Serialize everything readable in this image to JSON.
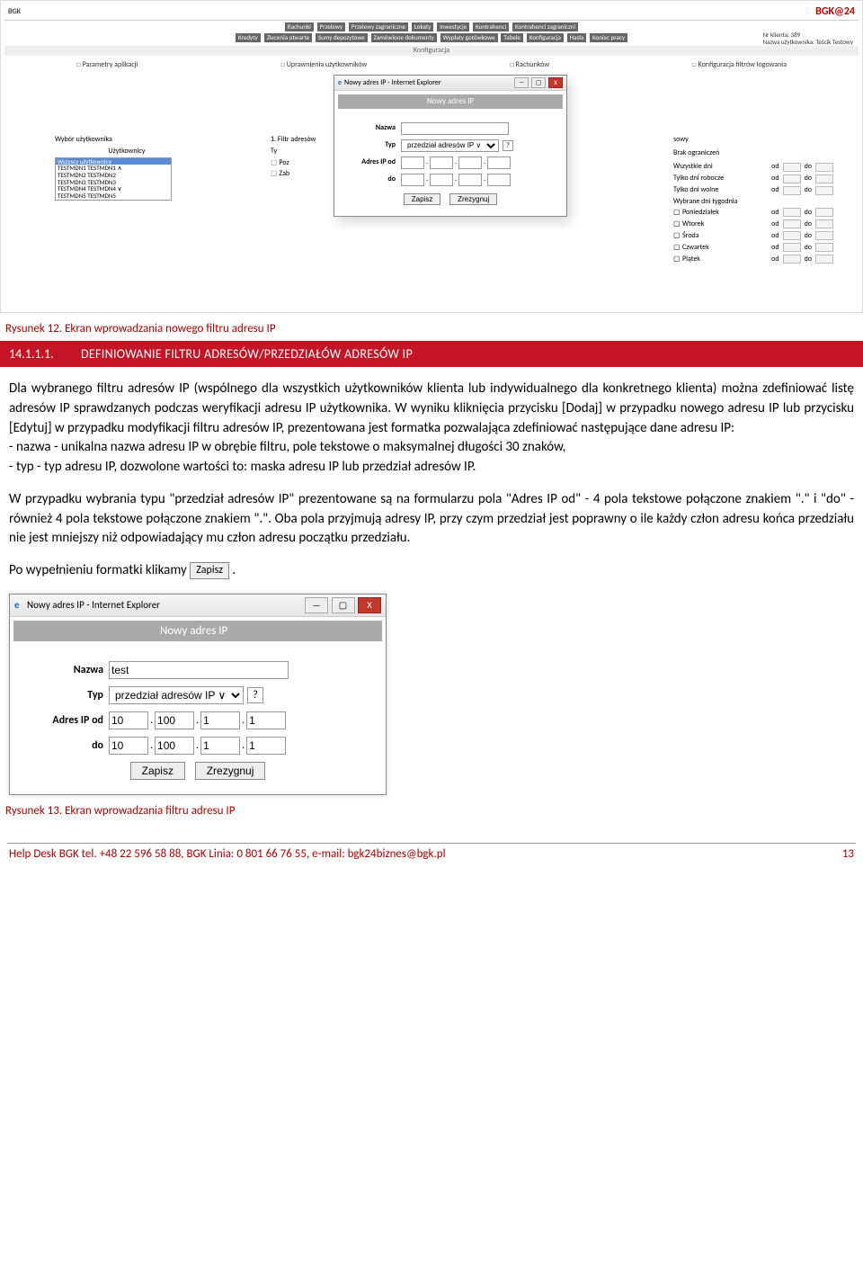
{
  "app": {
    "logo": "BGK",
    "brand": "BGK@24",
    "menu1": [
      "Rachunki",
      "Przelewy",
      "Przelewy zagraniczne",
      "Lokaty",
      "Inwestycje",
      "Kontrahenci",
      "Kontrahenci zagraniczni"
    ],
    "menu2": [
      "Kredyty",
      "Zlecenia otwarte",
      "Sumy depozytowe",
      "Zamówione dokumenty",
      "Wypłaty gotówkowe",
      "Tabele",
      "Konfiguracja",
      "Hasła",
      "Koniec pracy"
    ],
    "client_line1": "Nr klienta: 389",
    "client_line2": "Nazwa użytkownika: Teścik Testowy",
    "cfg": "Konfiguracja",
    "tabs": [
      "Parametry aplikacji",
      "Uprawnienia użytkowników",
      "Konfiguracja filtrów logowania"
    ],
    "tabs_mid": "Rachunków",
    "left": {
      "label": "Wybór użytkownika",
      "uz": "Użytkownicy",
      "sel": "Wszyscy użytkownicy",
      "items": [
        "TESTMDN1 TESTMDN1 ∧",
        "TESTMDN2 TESTMDN2",
        "TESTMDN3 TESTMDN3",
        "TESTMDN4 TESTMDN4 ∨",
        "TESTMDN5 TESTMDN5"
      ]
    },
    "mid": {
      "label": "1. Filtr adresów",
      "ty": "Ty",
      "ck1": "Poz",
      "ck2": "Zab"
    },
    "right": {
      "hdr": "sowy",
      "sub": "Brak ograniczeń",
      "rows": [
        "Wszystkie dni",
        "Tylko dni robocze",
        "Tylko dni wolne",
        "Wybrane dni tygodnia",
        "Poniedziałek",
        "Wtorek",
        "Środa",
        "Czwartek",
        "Piątek"
      ],
      "od": "od",
      "do": "do"
    }
  },
  "dialog_small": {
    "title": "Nowy adres IP - Internet Explorer",
    "sub": "Nowy adres IP",
    "nazwa_label": "Nazwa",
    "typ_label": "Typ",
    "typ_value": "przedział adresów IP ∨",
    "ip_od_label": "Adres IP od",
    "do_label": "do",
    "zapisz": "Zapisz",
    "zrezygnuj": "Zrezygnuj"
  },
  "caption12": "Rysunek 12. Ekran wprowadzania nowego filtru adresu IP",
  "heading": {
    "num": "14.1.1.1.",
    "title": "DEFINIOWANIE FILTRU ADRESÓW/PRZEDZIAŁÓW ADRESÓW IP"
  },
  "p1": "Dla wybranego filtru adresów IP (wspólnego dla wszystkich użytkowników klienta lub indywidualnego dla konkretnego klienta) można zdefiniować listę adresów IP sprawdzanych podczas weryfikacji adresu IP użytkownika. W wyniku kliknięcia przycisku [Dodaj] w przypadku nowego adresu IP lub przycisku [Edytuj] w przypadku modyfikacji filtru adresów IP, prezentowana jest formatka pozwalająca zdefiniować następujące dane adresu IP:",
  "p1b": "- nazwa - unikalna nazwa adresu IP w obrębie filtru, pole tekstowe o maksymalnej długości 30 znaków,",
  "p1c": "- typ - typ adresu IP, dozwolone wartości to: maska adresu IP lub przedział adresów IP.",
  "p2": "W przypadku wybrania typu \"przedział adresów IP\" prezentowane są na formularzu pola \"Adres IP od\" - 4 pola tekstowe połączone znakiem \".\" i \"do\" - również 4 pola tekstowe połączone znakiem \".\". Oba pola przyjmują adresy IP, przy czym przedział jest poprawny o ile każdy człon adresu końca przedziału nie jest mniejszy niż odpowiadający mu człon adresu początku przedziału.",
  "p3_prefix": "Po wypełnieniu formatki klikamy ",
  "p3_btn": "Zapisz",
  "p3_suffix": ".",
  "dialog_big": {
    "title": "Nowy adres IP - Internet Explorer",
    "sub": "Nowy adres IP",
    "nazwa_label": "Nazwa",
    "nazwa_value": "test",
    "typ_label": "Typ",
    "typ_value": "przedział adresów IP ∨",
    "ip_od_label": "Adres IP od",
    "do_label": "do",
    "od": [
      "10",
      "100",
      "1",
      "1"
    ],
    "to": [
      "10",
      "100",
      "1",
      "1"
    ],
    "zapisz": "Zapisz",
    "zrezygnuj": "Zrezygnuj"
  },
  "caption13": "Rysunek 13. Ekran wprowadzania filtru adresu IP",
  "footer": {
    "left": "Help Desk BGK tel. +48  22 596 58 88, BGK Linia: 0 801 66 76 55, e-mail: bgk24biznes@bgk.pl",
    "right": "13"
  }
}
